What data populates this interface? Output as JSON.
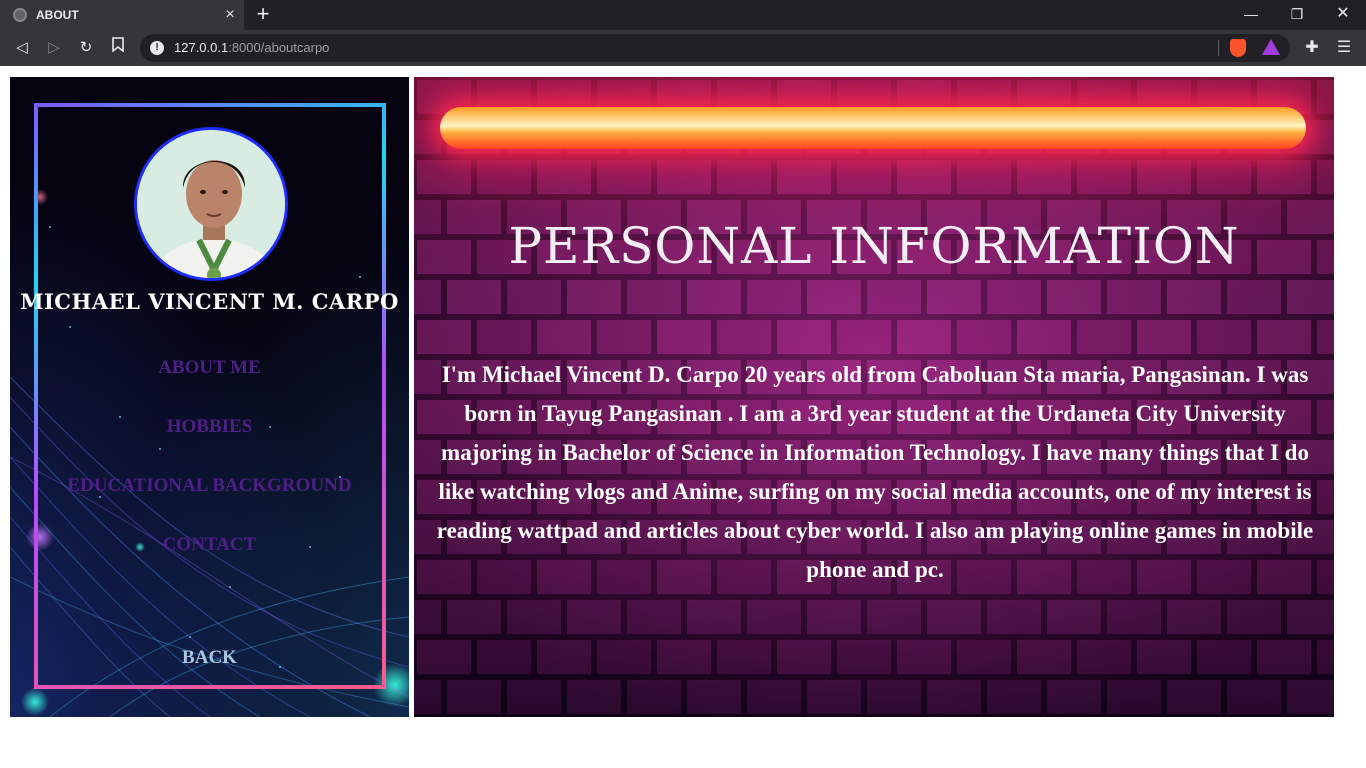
{
  "browser": {
    "tab_title": "ABOUT",
    "new_tab_icon": "+",
    "url_host": "127.0.0.1",
    "url_path": ":8000/aboutcarpo"
  },
  "sidebar": {
    "name": "MICHAEL VINCENT M. CARPO",
    "nav": {
      "about": "ABOUT ME",
      "hobbies": "HOBBIES",
      "education": "EDUCATIONAL BACKGROUND",
      "contact": "CONTACT",
      "back": "BACK"
    }
  },
  "main": {
    "title": "PERSONAL INFORMATION",
    "body": "I'm Michael Vincent D. Carpo 20 years old from Caboluan Sta maria, Pangasinan. I was born in Tayug Pangasinan . I am a 3rd year student at the Urdaneta City University majoring in Bachelor of Science in Information Technology. I have many things that I do like watching vlogs and Anime, surfing on my social media accounts, one of my interest is reading wattpad and articles about cyber world. I also am playing online games in mobile phone and pc."
  },
  "colors": {
    "nav_link": "#4e1f86",
    "back_link": "#aac7e0",
    "avatar_border": "#1d2cff",
    "neon": "#ff4080"
  },
  "icons": [
    "globe-icon",
    "close-icon",
    "plus-icon",
    "minimize-icon",
    "maximize-icon",
    "back-icon",
    "forward-icon",
    "reload-icon",
    "bookmark-icon",
    "info-icon",
    "brave-shield-icon",
    "brave-rewards-icon",
    "extensions-icon",
    "menu-icon"
  ]
}
